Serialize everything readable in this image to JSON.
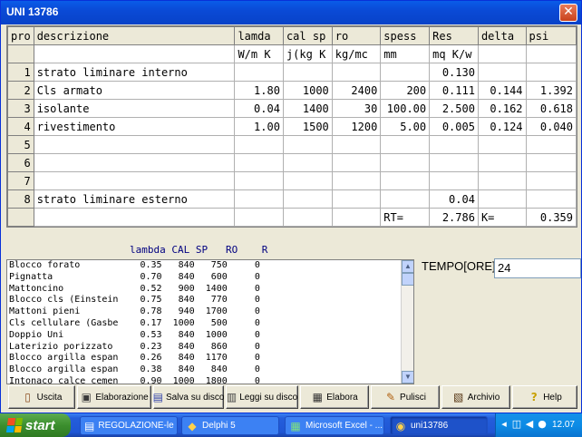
{
  "window": {
    "title": "UNI 13786",
    "close_glyph": "✕"
  },
  "grid": {
    "headers": [
      "pro",
      "descrizione",
      "lamda",
      "cal sp",
      "ro",
      "spess",
      "Res",
      "delta",
      "psi"
    ],
    "units": [
      "",
      "",
      "W/m K",
      "j(kg K",
      "kg/mc",
      "mm",
      "mq K/w",
      "",
      ""
    ],
    "rows": [
      {
        "n": "1",
        "desc": "strato liminare interno",
        "lamda": "",
        "cal": "",
        "ro": "",
        "spess": "",
        "res": "0.130",
        "delta": "",
        "psi": ""
      },
      {
        "n": "2",
        "desc": "Cls armato",
        "lamda": "1.80",
        "cal": "1000",
        "ro": "2400",
        "spess": "200",
        "res": "0.111",
        "delta": "0.144",
        "psi": "1.392"
      },
      {
        "n": "3",
        "desc": "isolante",
        "lamda": "0.04",
        "cal": "1400",
        "ro": "30",
        "spess": "100.00",
        "res": "2.500",
        "delta": "0.162",
        "psi": "0.618"
      },
      {
        "n": "4",
        "desc": "rivestimento",
        "lamda": "1.00",
        "cal": "1500",
        "ro": "1200",
        "spess": "5.00",
        "res": "0.005",
        "delta": "0.124",
        "psi": "0.040"
      },
      {
        "n": "5",
        "desc": "",
        "lamda": "",
        "cal": "",
        "ro": "",
        "spess": "",
        "res": "",
        "delta": "",
        "psi": ""
      },
      {
        "n": "6",
        "desc": "",
        "lamda": "",
        "cal": "",
        "ro": "",
        "spess": "",
        "res": "",
        "delta": "",
        "psi": ""
      },
      {
        "n": "7",
        "desc": "",
        "lamda": "",
        "cal": "",
        "ro": "",
        "spess": "",
        "res": "",
        "delta": "",
        "psi": ""
      },
      {
        "n": "8",
        "desc": "strato liminare esterno",
        "lamda": "",
        "cal": "",
        "ro": "",
        "spess": "",
        "res": "0.04",
        "delta": "",
        "psi": ""
      }
    ],
    "totals": {
      "rt_label": "RT=",
      "rt_value": "2.786",
      "k_label": "K=",
      "k_value": "0.359"
    }
  },
  "materials": {
    "header": "lambda CAL SP   RO    R",
    "items": [
      "Blocco forato           0.35   840   750     0",
      "Pignatta                0.70   840   600     0",
      "Mattoncino              0.52   900  1400     0",
      "Blocco cls (Einstein    0.75   840   770     0",
      "Mattoni pieni           0.78   940  1700     0",
      "Cls cellulare (Gasbe    0.17  1000   500     0",
      "Doppio Uni              0.53   840  1000     0",
      "Laterizio porizzato     0.23   840   860     0",
      "Blocco argilla espan    0.26   840  1170     0",
      "Blocco argilla espan    0.38   840   840     0",
      "Intonaco calce cemen    0.90  1000  1800     0"
    ]
  },
  "tempo": {
    "label": "TEMPO[ORE]",
    "value": "24"
  },
  "toolbar": {
    "uscita": "Uscita",
    "elaborazione": "Elaborazione",
    "salva": "Salva su disco",
    "leggi": "Leggi  su disco",
    "elabora": "Elabora",
    "pulisci": "Pulisci",
    "archivio": "Archivio",
    "help": "Help"
  },
  "taskbar": {
    "start": "start",
    "tasks": [
      "REGOLAZIONE-le ...",
      "Delphi 5",
      "Microsoft Excel - ...",
      "uni13786"
    ],
    "clock": "12.07"
  },
  "colors": {
    "title_blue": "#0a4ad6",
    "taskbar_blue": "#245edb",
    "start_green": "#3c8f2e",
    "face": "#ece9d8"
  }
}
